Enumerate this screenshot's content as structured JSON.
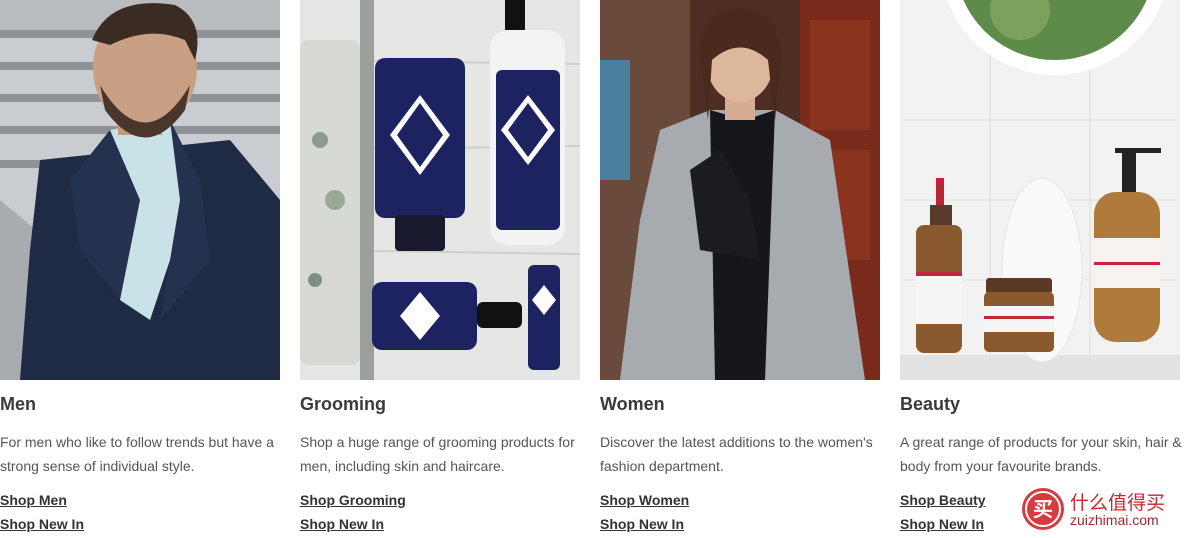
{
  "categories": [
    {
      "title": "Men",
      "description": "For men who like to follow trends but have a strong sense of individual style.",
      "links": [
        "Shop Men",
        "Shop New In"
      ],
      "image": "man-in-navy-blazer-photo"
    },
    {
      "title": "Grooming",
      "description": "Shop a huge range of grooming products for men, including skin and haircare.",
      "links": [
        "Shop Grooming",
        "Shop New In"
      ],
      "image": "grooming-products-photo"
    },
    {
      "title": "Women",
      "description": "Discover the latest additions to the women's fashion department.",
      "links": [
        "Shop Women",
        "Shop New In"
      ],
      "image": "woman-in-grey-coat-photo"
    },
    {
      "title": "Beauty",
      "description": "A great range of products for your skin, hair & body from your favourite brands.",
      "links": [
        "Shop Beauty",
        "Shop New In"
      ],
      "image": "beauty-bottles-photo"
    }
  ],
  "watermark": {
    "name": "什么值得买",
    "domain": "zuizhimai.com"
  },
  "colors": {
    "title": "#3a3a3a",
    "text": "#555555",
    "link": "#333333",
    "watermark": "#c8262d"
  }
}
